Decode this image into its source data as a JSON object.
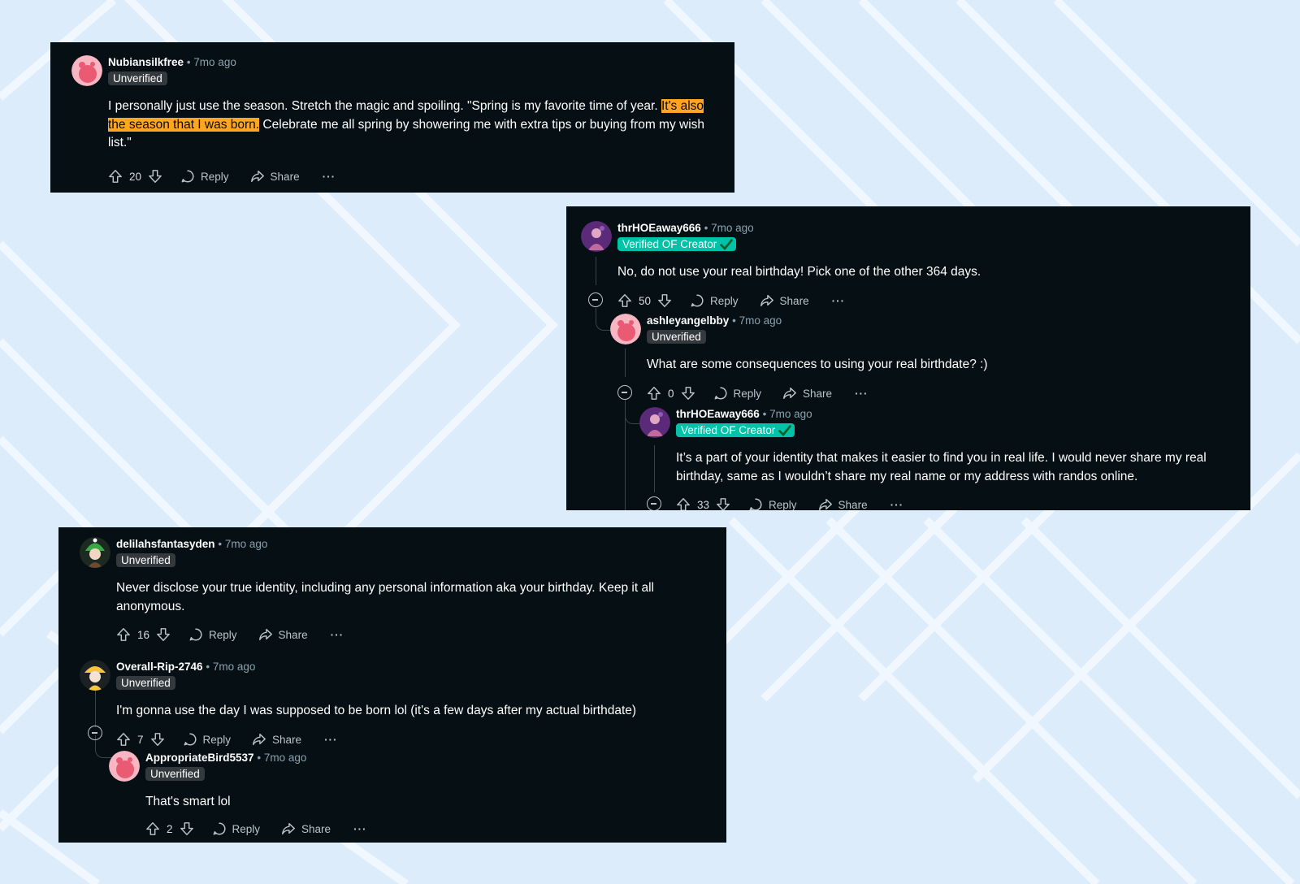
{
  "comments": {
    "c1": {
      "username": "Nubiansilkfree",
      "separator": "•",
      "time": "7mo ago",
      "badge": "Unverified",
      "text_before": "I personally just use the season. Stretch the magic and spoiling. \"Spring is my favorite time of year. ",
      "text_highlight": "It's also the season that I was born.",
      "text_after": " Celebrate me all spring by showering me with extra tips or buying from my wish list.\"",
      "votes": "20",
      "reply_label": "Reply",
      "share_label": "Share",
      "more_label": "···"
    },
    "c2": {
      "username": "thrHOEaway666",
      "separator": "•",
      "time": "7mo ago",
      "badge": "Verified OF Creator",
      "text": "No, do not use your real birthday! Pick one of the other 364 days.",
      "votes": "50",
      "reply_label": "Reply",
      "share_label": "Share",
      "more_label": "···"
    },
    "c3": {
      "username": "ashleyangelbby",
      "separator": "•",
      "time": "7mo ago",
      "badge": "Unverified",
      "text": "What are some consequences to using your real birthdate? :)",
      "votes": "0",
      "reply_label": "Reply",
      "share_label": "Share",
      "more_label": "···"
    },
    "c4": {
      "username": "thrHOEaway666",
      "separator": "•",
      "time": "7mo ago",
      "badge": "Verified OF Creator",
      "text": "It’s a part of your identity that makes it easier to find you in real life. I would never share my real birthday, same as I wouldn’t share my real name or my address with randos online.",
      "votes": "33",
      "reply_label": "Reply",
      "share_label": "Share",
      "more_label": "···"
    },
    "c5": {
      "username": "delilahsfantasyden",
      "separator": "•",
      "time": "7mo ago",
      "badge": "Unverified",
      "text": "Never disclose your true identity, including any personal information aka your birthday. Keep it all anonymous.",
      "votes": "16",
      "reply_label": "Reply",
      "share_label": "Share",
      "more_label": "···"
    },
    "c6": {
      "username": "Overall-Rip-2746",
      "separator": "•",
      "time": "7mo ago",
      "badge": "Unverified",
      "text": "I'm gonna use the day I was supposed to be born lol (it's a few days after my actual birthdate)",
      "votes": "7",
      "reply_label": "Reply",
      "share_label": "Share",
      "more_label": "···"
    },
    "c7": {
      "username": "AppropriateBird5537",
      "separator": "•",
      "time": "7mo ago",
      "badge": "Unverified",
      "text": "That's smart lol",
      "votes": "2",
      "reply_label": "Reply",
      "share_label": "Share",
      "more_label": "···"
    }
  },
  "colors": {
    "background": "#dcecfb",
    "panel": "#050f14",
    "highlight": "#ffa51f",
    "verified_badge": "#00c2a8",
    "unverified_badge": "#33393d"
  },
  "icons": [
    "upvote-icon",
    "downvote-icon",
    "reply-icon",
    "share-icon",
    "collapse-icon",
    "checkmark-icon"
  ]
}
